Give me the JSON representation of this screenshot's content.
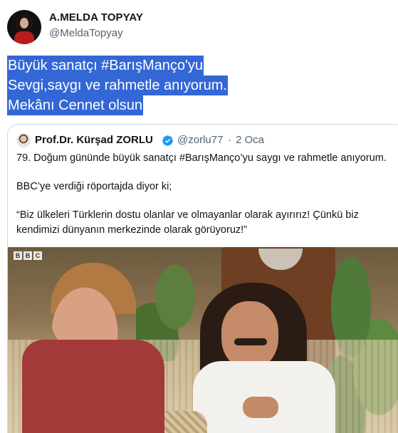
{
  "author": {
    "name": "A.MELDA TOPYAY",
    "handle": "@MeldaTopyay"
  },
  "tweet": {
    "lines": [
      "Büyük sanatçı #BarışManço'yu",
      "Sevgi,saygı ve rahmetle anıyorum.",
      "Mekânı Cennet olsun"
    ]
  },
  "quoted": {
    "name": "Prof.Dr. Kürşad ZORLU",
    "handle": "@zorlu77",
    "separator": "·",
    "date": "2 Oca",
    "paragraphs": [
      "79. Doğum gününde büyük sanatçı #BarışManço’yu saygı ve rahmetle anıyorum.",
      "BBC’ye verdiği röportajda diyor ki;",
      "“Biz ülkeleri Türklerin dostu olanlar ve olmayanlar olarak ayırırız! Çünkü biz kendimizi dünyanın merkezinde olarak görüyoruz!”"
    ],
    "video": {
      "watermark": [
        "B",
        "B",
        "C"
      ]
    }
  },
  "colors": {
    "selection": "#3367d6",
    "verified": "#1d9bf0",
    "secondary_text": "#536471",
    "border": "#cfd9de"
  },
  "icons": {
    "verified": "verified-badge-icon"
  }
}
